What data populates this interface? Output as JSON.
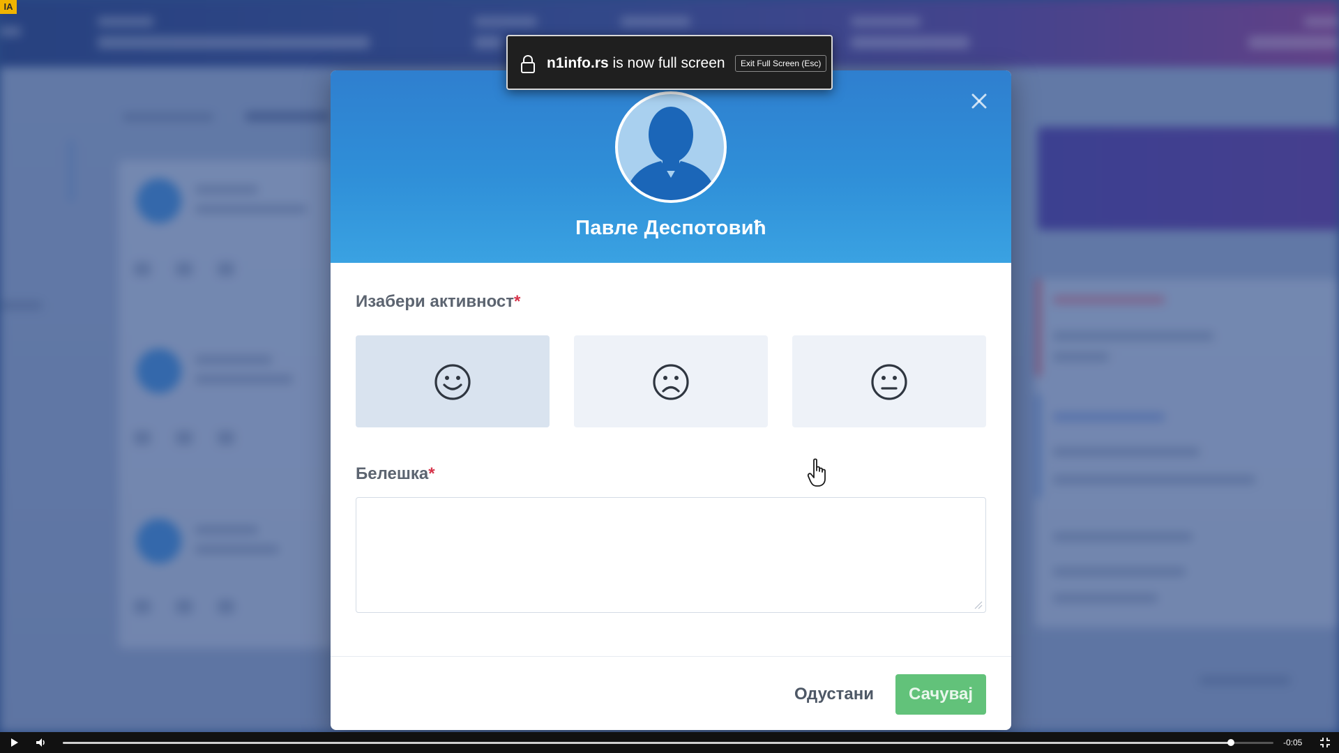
{
  "corner_badge": "ΙΑ",
  "fullscreen_notice": {
    "domain": "n1info.rs",
    "message": " is now full screen",
    "exit_label": "Exit Full Screen (Esc)"
  },
  "modal": {
    "user_name": "Павле Деспотовић",
    "close_icon": "close-icon",
    "activity_label": "Изабери активност",
    "note_label": "Белешка",
    "required_mark": "*",
    "activity_options": [
      {
        "icon": "smile-icon",
        "selected": true
      },
      {
        "icon": "frown-icon",
        "selected": false
      },
      {
        "icon": "neutral-face-icon",
        "selected": false
      }
    ],
    "note_value": "",
    "cancel_label": "Одустани",
    "save_label": "Сачувај"
  },
  "video_controls": {
    "time_remaining": "-0:05",
    "progress": 0.965
  },
  "colors": {
    "header_gradient_start": "#2f7fcf",
    "header_gradient_end": "#3aa2e2",
    "required": "#d6334a",
    "save_button": "#62c27a",
    "selected_option": "#d9e3ef",
    "option": "#eef2f8"
  }
}
